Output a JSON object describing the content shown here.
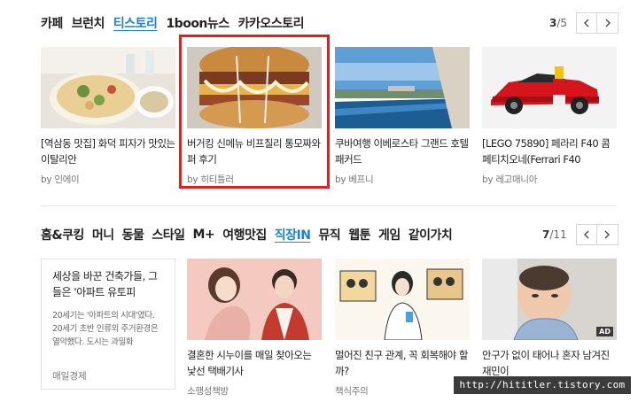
{
  "section1": {
    "tabs": [
      "카페",
      "브런치",
      "티스토리",
      "1boon뉴스",
      "카카오스토리"
    ],
    "active_tab": "티스토리",
    "pager": {
      "current": "3",
      "total": "/5"
    },
    "cards": [
      {
        "title": "[역삼동 맛집] 화덕 피자가 맛있는 이탈리안",
        "byline": "by 인에이"
      },
      {
        "title": "버거킹 신메뉴 비프칠리 통모짜와퍼 후기",
        "byline": "by 히티틀러"
      },
      {
        "title": "쿠바여행 이베로스타 그랜드 호텔 패커드",
        "byline": "by 베프니"
      },
      {
        "title": "[LEGO 75890] 페라리 F40 콤페티치오네(Ferrari F40",
        "byline": "by 레고매니아"
      }
    ]
  },
  "section2": {
    "tabs": [
      "홈&쿠킹",
      "머니",
      "동물",
      "스타일",
      "M+",
      "여행맛집",
      "직장IN",
      "뮤직",
      "웹툰",
      "게임",
      "같이가치"
    ],
    "active_tab": "직장IN",
    "pager": {
      "current": "7",
      "total": "/11"
    },
    "text_card": {
      "headline": "세상을 바꾼 건축가들, 그들은 '아파트 유토피",
      "excerpt": "20세기는 '아파트의 시대'였다. 20세기 초반 인류의 주거환경은 열악했다. 도시는 과밀화",
      "source": "매일경제"
    },
    "cards": [
      {
        "title": "결혼한 시누이를 매일 찾아오는 낯선 택배기사",
        "byline": "소행성책방"
      },
      {
        "title": "멀어진 친구 관계, 꼭 회복해야 할까?",
        "byline": "책식주의"
      },
      {
        "title": "안구가 없이 태어나 혼자 남겨진 재민이",
        "byline": "",
        "badge": "AD"
      }
    ]
  },
  "watermark": "http://hititler.tistory.com",
  "colors": {
    "accent": "#1e7fd1",
    "highlight": "#e02020"
  }
}
